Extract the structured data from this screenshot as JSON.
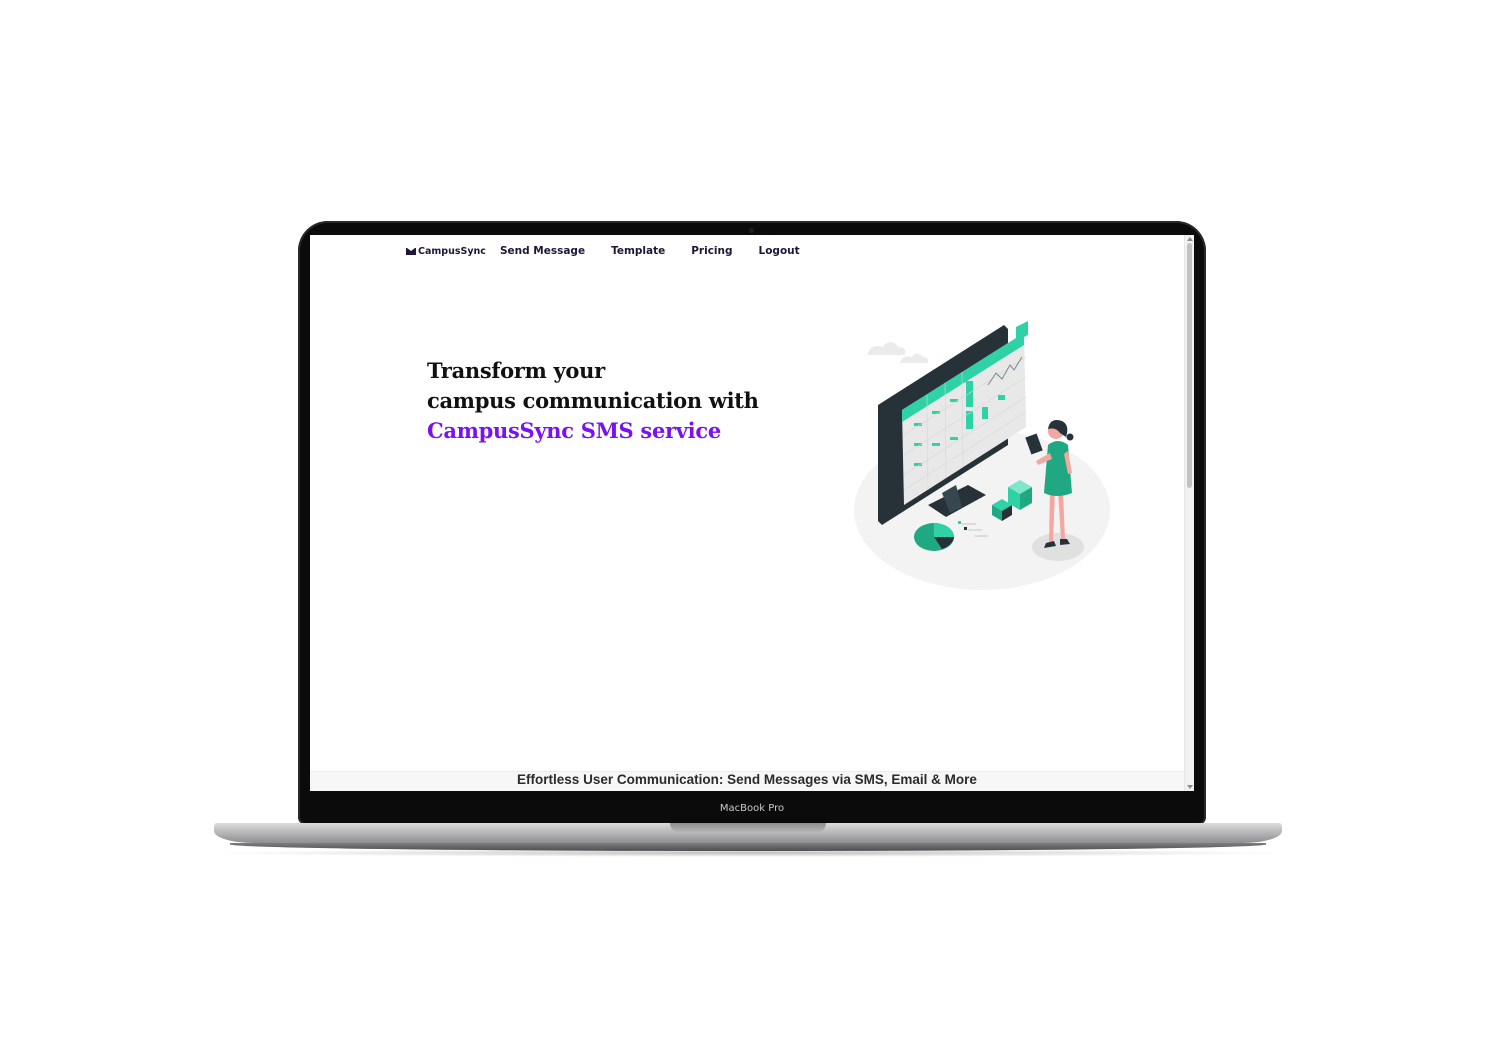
{
  "device": {
    "model_label": "MacBook Pro"
  },
  "nav": {
    "brand": "CampusSync",
    "links": [
      "Send Message",
      "Template",
      "Pricing",
      "Logout"
    ]
  },
  "hero": {
    "line1": "Transform your",
    "line2": "campus communication with",
    "highlight": "CampusSync SMS service"
  },
  "illustration": {
    "icon": "analytics-dashboard-illustration"
  },
  "footer_banner": "Effortless User Communication: Send Messages via SMS, Email & More",
  "colors": {
    "accent": "#7a12f0",
    "nav_text": "#1e1538",
    "teal": "#2fd1a7",
    "dark_monitor": "#263238"
  }
}
